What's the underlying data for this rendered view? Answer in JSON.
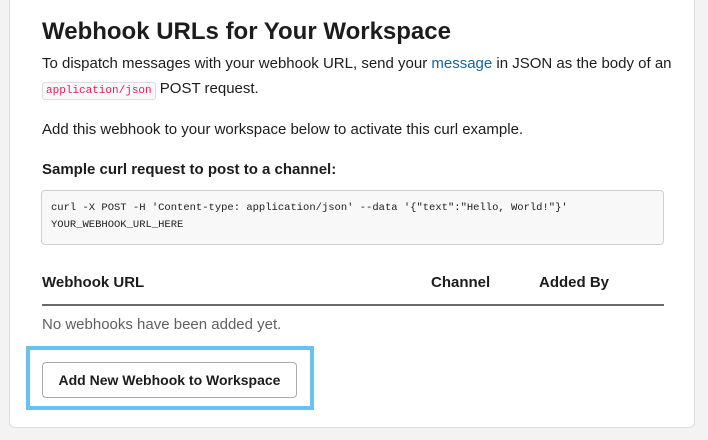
{
  "section": {
    "title": "Webhook URLs for Your Workspace",
    "intro": {
      "part1": "To dispatch messages with your webhook URL, send your ",
      "link": "message",
      "part2": " in JSON as the body of an ",
      "code": "application/json",
      "part3": " POST request."
    },
    "add_instruction": "Add this webhook to your workspace below to activate this curl example.",
    "sample_label": "Sample curl request to post to a channel:",
    "code_lines": [
      "curl -X POST -H 'Content-type: application/json' --data '{\"text\":\"Hello, World!\"}'",
      "YOUR_WEBHOOK_URL_HERE"
    ]
  },
  "table": {
    "columns": [
      "Webhook URL",
      "Channel",
      "Added By"
    ],
    "empty_message": "No webhooks have been added yet."
  },
  "actions": {
    "add_button_label": "Add New Webhook to Workspace",
    "highlight_color": "#66c2f2"
  },
  "colors": {
    "link": "#1264a3",
    "inline_code": "#e01e5a"
  }
}
